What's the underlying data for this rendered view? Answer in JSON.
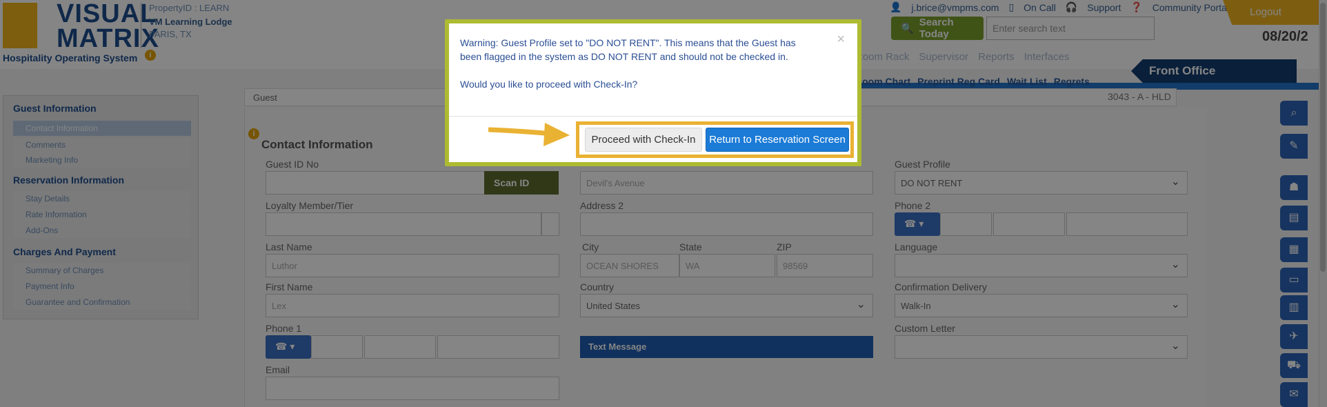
{
  "header": {
    "logo_line1": "VISUAL",
    "logo_line2": "MATRIX",
    "logo_tagline": "Hospitality Operating System",
    "property_id": "PropertyID : LEARN",
    "property_name": "VM Learning Lodge",
    "property_city": "PARIS, TX",
    "user_email": "j.brice@vmpms.com",
    "on_call": "On Call",
    "support": "Support",
    "community_portal": "Community Portal",
    "logout": "Logout",
    "search_button": "Search Today",
    "search_placeholder": "Enter search text",
    "date": "08/20/2"
  },
  "nav": {
    "items": [
      "Room Rack",
      "Supervisor",
      "Reports",
      "Interfaces"
    ],
    "front_office": "Front Office",
    "sub_items": [
      "Room Chart",
      "Preprint Reg Card",
      "Wait List",
      "Regrets"
    ]
  },
  "sidebar": {
    "guest_info_heading": "Guest Information",
    "guest_items": [
      "Contact Information",
      "Comments",
      "Marketing Info"
    ],
    "reservation_heading": "Reservation Information",
    "reservation_items": [
      "Stay Details",
      "Rate Information",
      "Add-Ons"
    ],
    "charges_heading": "Charges And Payment",
    "charges_items": [
      "Summary of Charges",
      "Payment Info",
      "Guarantee and Confirmation"
    ]
  },
  "main": {
    "guest_tab": "Guest",
    "reference": "3043 - A - HLD",
    "section_title": "Contact Information",
    "fields": {
      "guest_id_label": "Guest ID No",
      "scan_id": "Scan ID",
      "loyalty_label": "Loyalty Member/Tier",
      "last_name_label": "Last Name",
      "last_name_value": "Luthor",
      "first_name_label": "First Name",
      "first_name_value": "Lex",
      "phone1_label": "Phone 1",
      "email_label": "Email",
      "address1_value": "Devil's Avenue",
      "address2_label": "Address 2",
      "city_label": "City",
      "city_value": "OCEAN SHORES",
      "state_label": "State",
      "state_value": "WA",
      "zip_label": "ZIP",
      "zip_value": "98569",
      "country_label": "Country",
      "country_value": "United States",
      "text_message": "Text Message",
      "guest_profile_label": "Guest Profile",
      "guest_profile_value": "DO NOT RENT",
      "phone2_label": "Phone 2",
      "language_label": "Language",
      "confirmation_delivery_label": "Confirmation Delivery",
      "confirmation_delivery_value": "Walk-In",
      "custom_letter_label": "Custom Letter"
    }
  },
  "modal": {
    "warning_text": "Warning: Guest Profile set to \"DO NOT RENT\". This means that the Guest has been flagged in the system as DO NOT RENT and should not be checked in.",
    "question": "Would you like to proceed with Check-In?",
    "close": "×",
    "proceed_button": "Proceed with Check-In",
    "return_button": "Return to Reservation Screen"
  },
  "colors": {
    "modal_border": "#aebb32",
    "highlight": "#eab233",
    "primary_button": "#1b7bd6",
    "brand_blue": "#1d4e8f"
  }
}
